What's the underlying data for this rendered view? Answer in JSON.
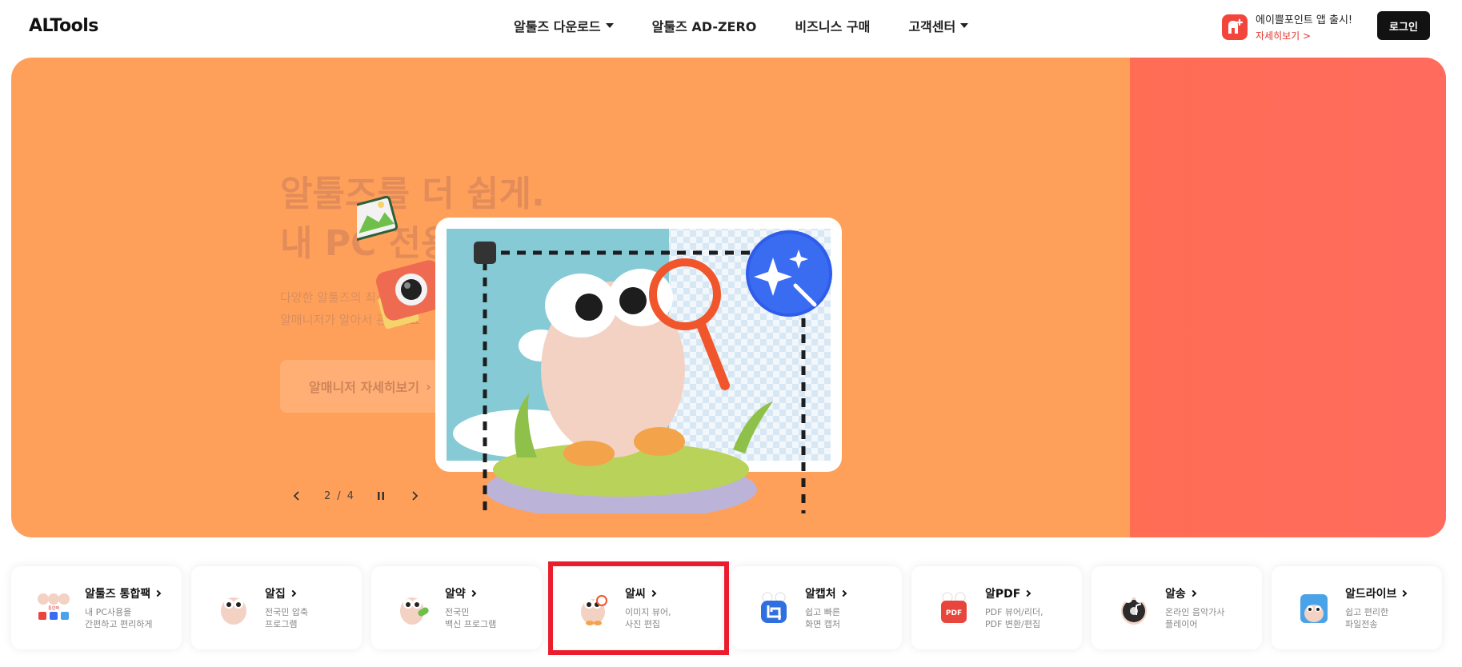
{
  "header": {
    "logo": "ALTools",
    "nav": [
      {
        "label": "알툴즈 다운로드",
        "has_dropdown": true
      },
      {
        "label": "알툴즈 AD-ZERO",
        "has_dropdown": false
      },
      {
        "label": "비즈니스 구매",
        "has_dropdown": false
      },
      {
        "label": "고객센터",
        "has_dropdown": true
      }
    ],
    "promo": {
      "title": "에이쁠포인트 앱 출시!",
      "link": "자세히보기 >"
    },
    "login_label": "로그인"
  },
  "hero": {
    "title_line1": "알툴즈를 더 쉽게.",
    "title_line2": "내 PC 전용 매니저",
    "sub_line1": "다양한 알툴즈의 최신 버전을 놓치지 않도록",
    "sub_line2": "알매니저가 알아서 관리해요",
    "cta_label": "알매니저 자세히보기",
    "pager": {
      "current": "2",
      "separator": "/",
      "total": "4"
    },
    "colors": {
      "main": "#ffa05a",
      "side": "#ff6d55"
    }
  },
  "products": [
    {
      "name": "알툴즈 통합팩",
      "desc1": "내 PC사용을",
      "desc2": "간편하고 편리하게",
      "icon": "altools-pack-icon"
    },
    {
      "name": "알집",
      "desc1": "전국민 압축",
      "desc2": "프로그램",
      "icon": "alzip-icon"
    },
    {
      "name": "알약",
      "desc1": "전국민",
      "desc2": "백신 프로그램",
      "icon": "alyac-icon"
    },
    {
      "name": "알씨",
      "desc1": "이미지 뷰어,",
      "desc2": "사진 편집",
      "icon": "alsee-icon"
    },
    {
      "name": "알캡처",
      "desc1": "쉽고 빠른",
      "desc2": "화면 캡처",
      "icon": "alcapture-icon"
    },
    {
      "name": "알PDF",
      "desc1": "PDF 뷰어/리더,",
      "desc2": "PDF 변환/편집",
      "icon": "alpdf-icon"
    },
    {
      "name": "알송",
      "desc1": "온라인 음악가사",
      "desc2": "플레이어",
      "icon": "alsong-icon"
    },
    {
      "name": "알드라이브",
      "desc1": "쉽고 편리한",
      "desc2": "파일전송",
      "icon": "aldrive-icon"
    }
  ],
  "highlight_color": "#ea1c2d"
}
